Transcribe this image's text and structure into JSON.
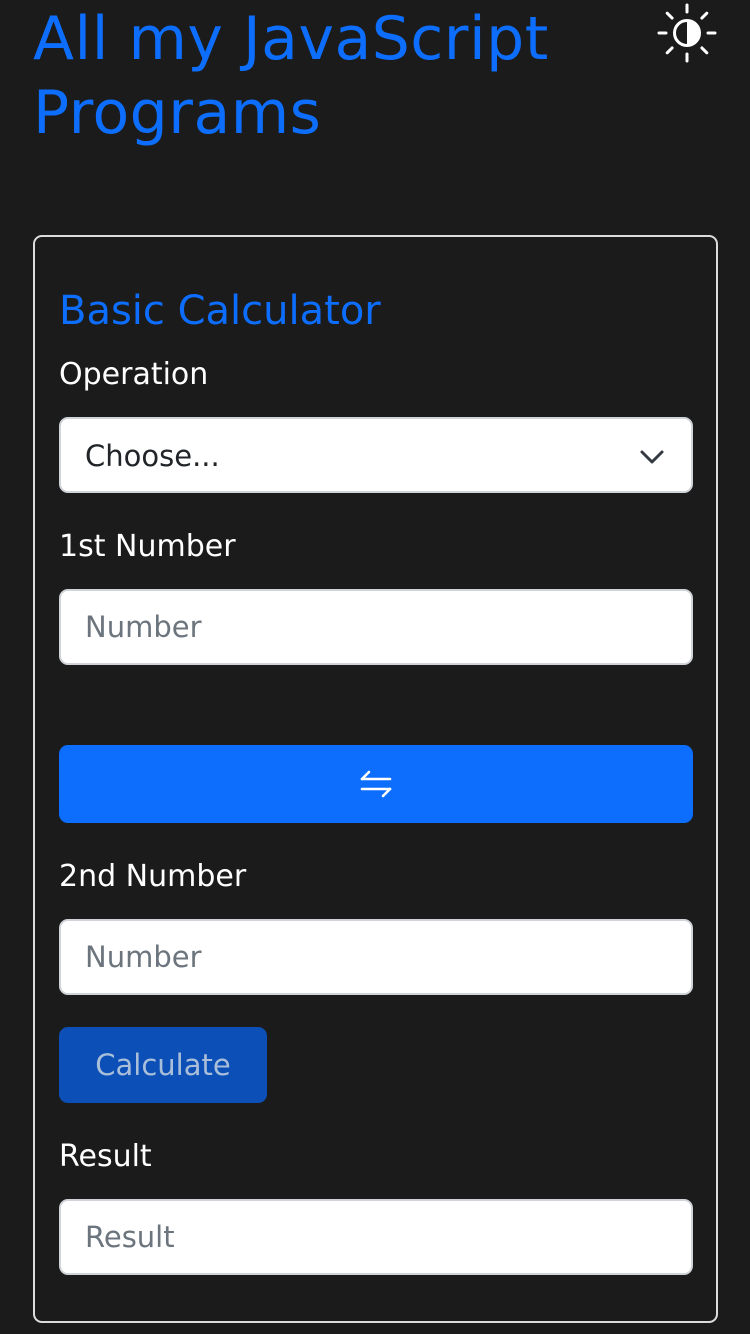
{
  "header": {
    "title": "All my JavaScript Programs",
    "theme_icon": "contrast-sun-icon"
  },
  "calculator": {
    "title": "Basic Calculator",
    "operation": {
      "label": "Operation",
      "selected": "Choose..."
    },
    "first_number": {
      "label": "1st Number",
      "placeholder": "Number"
    },
    "swap_icon": "swap-arrows-icon",
    "second_number": {
      "label": "2nd Number",
      "placeholder": "Number"
    },
    "calculate_label": "Calculate",
    "result": {
      "label": "Result",
      "placeholder": "Result"
    }
  },
  "colors": {
    "background": "#1b1b1b",
    "accent": "#0d6efd",
    "disabled_button": "#0b4fb7"
  }
}
